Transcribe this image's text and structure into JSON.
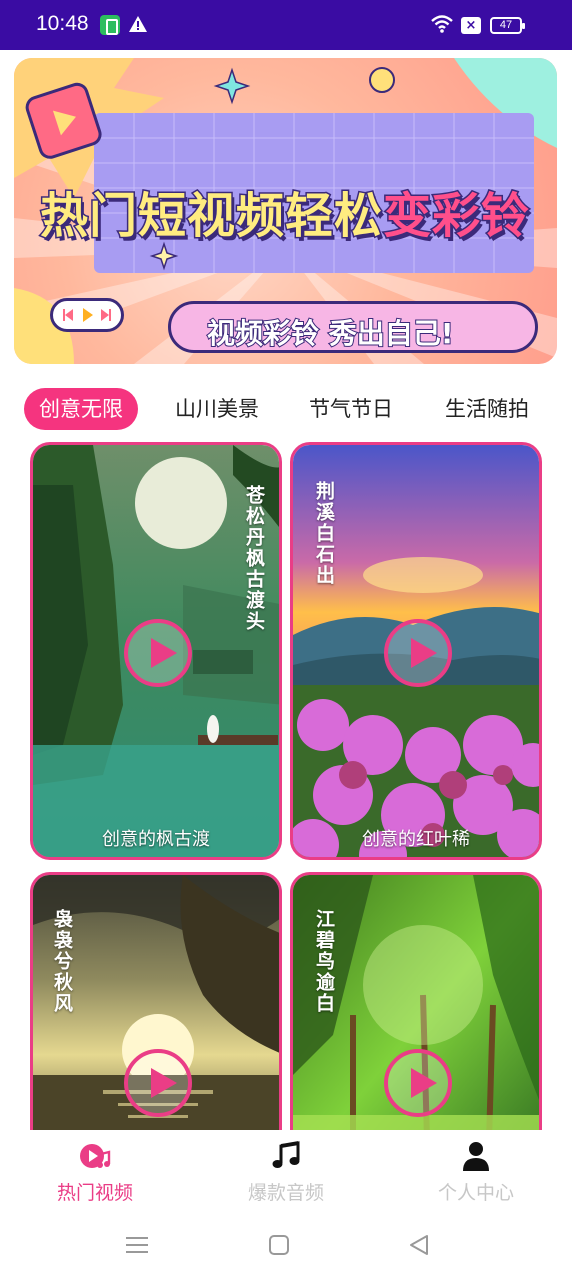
{
  "status_bar": {
    "time": "10:48",
    "battery": "47",
    "bg_color": "#3a0ca3"
  },
  "banner": {
    "title_main": "热门短视频轻松",
    "title_highlight": "变彩铃",
    "subtitle": "视频彩铃  秀出自己!"
  },
  "tabs": [
    {
      "label": "创意无限",
      "active": true
    },
    {
      "label": "山川美景",
      "active": false
    },
    {
      "label": "节气节日",
      "active": false
    },
    {
      "label": "生活随拍",
      "active": false
    }
  ],
  "cards": [
    {
      "caption": "创意的枫古渡",
      "poem": "苍松丹枫古渡头"
    },
    {
      "caption": "创意的红叶稀",
      "poem": "荆溪白石出"
    },
    {
      "caption": "",
      "poem": "袅袅兮秋风"
    },
    {
      "caption": "",
      "poem": "江碧鸟逾白"
    }
  ],
  "bottom_nav": [
    {
      "label": "热门视频",
      "icon": "music-video-icon",
      "active": true
    },
    {
      "label": "爆款音频",
      "icon": "music-note-icon",
      "active": false
    },
    {
      "label": "个人中心",
      "icon": "person-icon",
      "active": false
    }
  ],
  "accent_color": "#ea3d86"
}
